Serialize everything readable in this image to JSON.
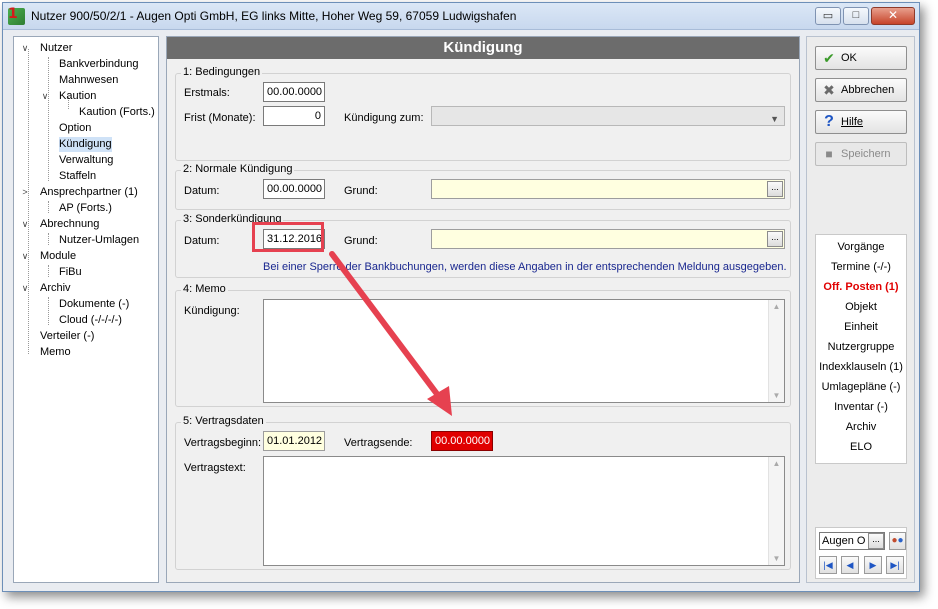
{
  "window": {
    "title": "Nutzer 900/50/2/1 - Augen Opti GmbH, EG links Mitte, Hoher Weg 59, 67059 Ludwigshafen",
    "icon_digit": "1",
    "buttons": {
      "minimize": "▭",
      "maximize": "□",
      "close": "✕"
    }
  },
  "tree": {
    "items": [
      {
        "label": "Nutzer",
        "toggle": "∨"
      },
      {
        "label": "Bankverbindung"
      },
      {
        "label": "Mahnwesen"
      },
      {
        "label": "Kaution",
        "toggle": "∨"
      },
      {
        "label": "Kaution (Forts.)"
      },
      {
        "label": "Option"
      },
      {
        "label": "Kündigung",
        "selected": true
      },
      {
        "label": "Verwaltung"
      },
      {
        "label": "Staffeln"
      },
      {
        "label": "Ansprechpartner (1)",
        "toggle": ">"
      },
      {
        "label": "AP (Forts.)"
      },
      {
        "label": "Abrechnung",
        "toggle": "∨"
      },
      {
        "label": "Nutzer-Umlagen"
      },
      {
        "label": "Module",
        "toggle": "∨"
      },
      {
        "label": "FiBu"
      },
      {
        "label": "Archiv",
        "toggle": "∨"
      },
      {
        "label": "Dokumente (-)"
      },
      {
        "label": "Cloud (-/-/-/-)"
      },
      {
        "label": "Verteiler (-)"
      },
      {
        "label": "Memo"
      }
    ]
  },
  "header": {
    "title": "Kündigung"
  },
  "bedingungen": {
    "title": "1: Bedingungen",
    "erstmals_label": "Erstmals:",
    "erstmals_value": "00.00.0000",
    "frist_label": "Frist (Monate):",
    "frist_value": "0",
    "kuendigung_zum_label": "Kündigung zum:",
    "kuendigung_zum_value": ""
  },
  "normale": {
    "title": "2: Normale Kündigung",
    "datum_label": "Datum:",
    "datum_value": "00.00.0000",
    "grund_label": "Grund:",
    "grund_value": "",
    "dots": "..."
  },
  "sonder": {
    "title": "3: Sonderkündigung",
    "datum_label": "Datum:",
    "datum_value": "31.12.2016",
    "grund_label": "Grund:",
    "grund_value": "",
    "dots": "...",
    "info_text": "Bei einer Sperre der Bankbuchungen, werden diese Angaben in der entsprechenden Meldung ausgegeben."
  },
  "memo": {
    "title": "4: Memo",
    "kuendigung_label": "Kündigung:",
    "kuendigung_value": ""
  },
  "vertrag": {
    "title": "5: Vertragsdaten",
    "beginn_label": "Vertragsbeginn:",
    "beginn_value": "01.01.2012",
    "ende_label": "Vertragsende:",
    "ende_value": "00.00.0000",
    "text_label": "Vertragstext:",
    "text_value": ""
  },
  "actions": {
    "ok": "OK",
    "abbrechen": "Abbrechen",
    "hilfe": "Hilfe",
    "speichern": "Speichern"
  },
  "links": [
    {
      "label": "Vorgänge"
    },
    {
      "label": "Termine (-/-)"
    },
    {
      "label": "Off. Posten (1)",
      "active": true
    },
    {
      "label": "Objekt"
    },
    {
      "label": "Einheit"
    },
    {
      "label": "Nutzergruppe"
    },
    {
      "label": "Indexklauseln (1)"
    },
    {
      "label": "Umlagepläne (-)"
    },
    {
      "label": "Inventar (-)"
    },
    {
      "label": "Archiv"
    },
    {
      "label": "ELO"
    }
  ],
  "nav": {
    "search_value": "Augen O",
    "dots": "...",
    "first": "|◀",
    "prev": "◀",
    "next": "▶",
    "last": "▶|"
  },
  "colors": {
    "header_bg": "#6c6c6c",
    "active_link": "#e00000",
    "highlight": "#e64150",
    "info_text": "#19278f"
  }
}
